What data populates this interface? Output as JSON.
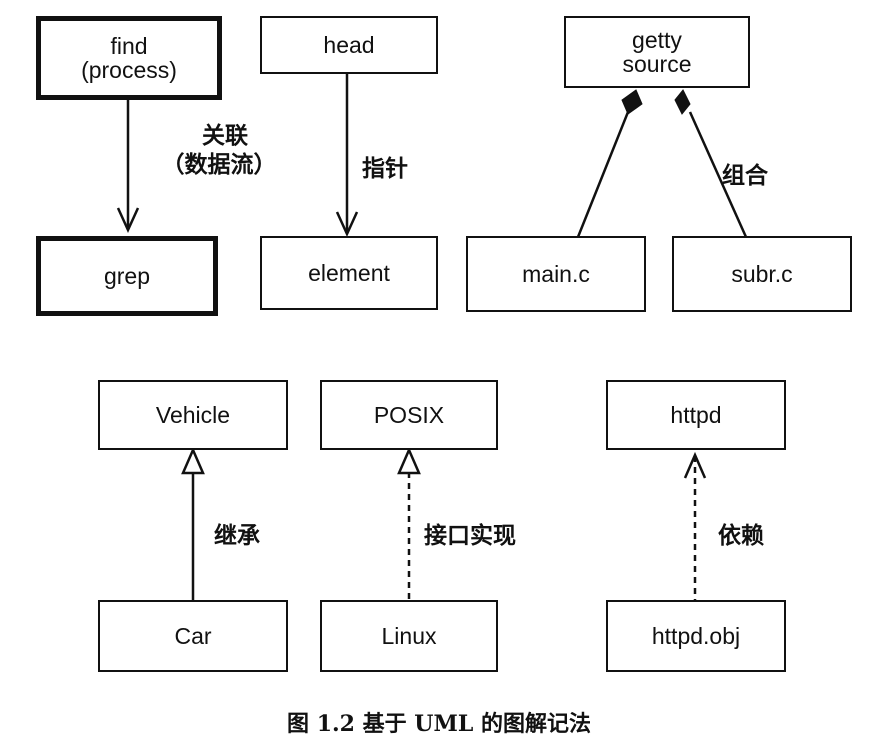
{
  "boxes": {
    "find": {
      "line1": "find",
      "line2": "(process)"
    },
    "grep": "grep",
    "head": "head",
    "element": "element",
    "getty": {
      "line1": "getty",
      "line2": "source"
    },
    "main_c": "main.c",
    "subr_c": "subr.c",
    "vehicle": "Vehicle",
    "car": "Car",
    "posix": "POSIX",
    "linux": "Linux",
    "httpd": "httpd",
    "httpd_obj": "httpd.obj"
  },
  "relations": {
    "association": {
      "line1": "关联",
      "line2": "（数据流）"
    },
    "pointer": "指针",
    "composition": "组合",
    "inheritance": "继承",
    "interface_realization": "接口实现",
    "dependency": "依赖"
  },
  "caption": "图 1.2   基于 UML 的图解记法"
}
